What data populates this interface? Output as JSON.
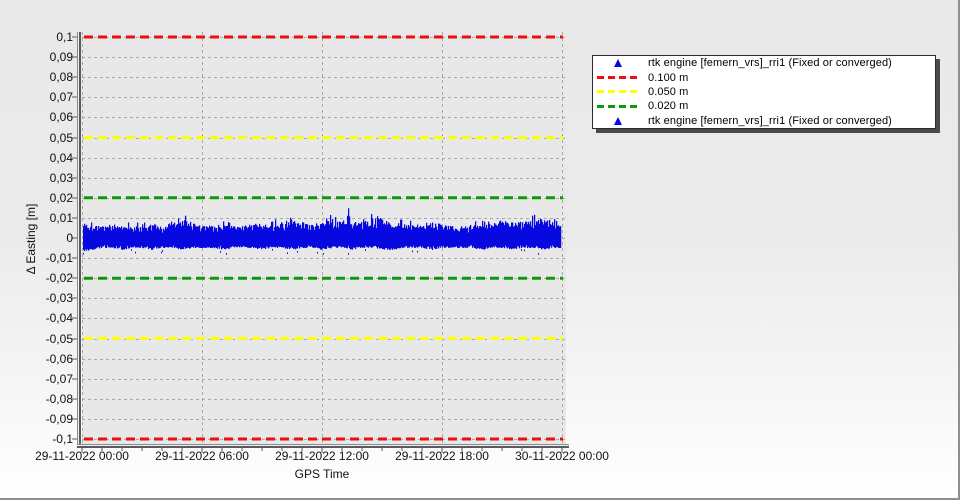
{
  "colors": {
    "plot_bg": "#e8e8e8",
    "grid": "#a8a8a8",
    "axis": "#5a5a5a",
    "series_blue": "#0808e0",
    "threshold_red": "#ee0e0e",
    "threshold_yellow": "#ffff00",
    "threshold_green": "#089b08",
    "legend_bg": "#ffffff",
    "window_bg_top": "#e9e9e9",
    "window_bg_bottom": "#ffffff"
  },
  "legend": {
    "items": [
      {
        "symbol": "triangle",
        "color": "#0808e0",
        "label": "rtk engine [femern_vrs]_rri1 (Fixed or converged)"
      },
      {
        "symbol": "dash",
        "color": "#ee0e0e",
        "label": "0.100 m"
      },
      {
        "symbol": "dash",
        "color": "#ffff00",
        "label": "0.050 m"
      },
      {
        "symbol": "dash",
        "color": "#089b08",
        "label": "0.020 m"
      },
      {
        "symbol": "triangle",
        "color": "#0808e0",
        "label": "rtk engine [femern_vrs]_rri1 (Fixed or converged)"
      }
    ]
  },
  "chart_data": {
    "type": "scatter",
    "title": "",
    "xlabel": "GPS Time",
    "ylabel": "Δ Easting [m]",
    "ylim": [
      -0.1,
      0.1
    ],
    "y_tick_step": 0.01,
    "y_tick_labels": [
      "0,1",
      "0,09",
      "0,08",
      "0,07",
      "0,06",
      "0,05",
      "0,04",
      "0,03",
      "0,02",
      "0,01",
      "0",
      "-0,01",
      "-0,02",
      "-0,03",
      "-0,04",
      "-0,05",
      "-0,06",
      "-0,07",
      "-0,08",
      "-0,09",
      "-0,1"
    ],
    "x_range_hours": [
      0,
      24
    ],
    "x_major_tick_hours": 6,
    "x_minor_tick_hours": 1,
    "x_tick_labels": [
      "29-11-2022 00:00",
      "29-11-2022 06:00",
      "29-11-2022 12:00",
      "29-11-2022 18:00",
      "30-11-2022 00:00"
    ],
    "grid": "dashed",
    "legend_position": "outside-right",
    "thresholds": [
      {
        "value": 0.1,
        "color": "#ee0e0e",
        "label": "0.100 m"
      },
      {
        "value": -0.1,
        "color": "#ee0e0e",
        "label": "0.100 m"
      },
      {
        "value": 0.05,
        "color": "#ffff00",
        "label": "0.050 m"
      },
      {
        "value": -0.05,
        "color": "#ffff00",
        "label": "0.050 m"
      },
      {
        "value": 0.02,
        "color": "#089b08",
        "label": "0.020 m"
      },
      {
        "value": -0.02,
        "color": "#089b08",
        "label": "0.020 m"
      }
    ],
    "series": [
      {
        "name": "rtk engine [femern_vrs]_rri1 (Fixed or converged)",
        "marker": "triangle",
        "color": "#0808e0",
        "description": "dense noise band of Δ Easting residuals around 0 m",
        "envelope_t_step_h": 0.5,
        "upper_envelope_m": [
          0.007,
          0.006,
          0.006,
          0.007,
          0.006,
          0.006,
          0.006,
          0.007,
          0.006,
          0.008,
          0.009,
          0.008,
          0.006,
          0.006,
          0.007,
          0.006,
          0.006,
          0.007,
          0.006,
          0.007,
          0.008,
          0.01,
          0.008,
          0.007,
          0.008,
          0.01,
          0.008,
          0.008,
          0.008,
          0.01,
          0.01,
          0.008,
          0.007,
          0.007,
          0.006,
          0.008,
          0.007,
          0.006,
          0.006,
          0.007,
          0.007,
          0.008,
          0.009,
          0.008,
          0.008,
          0.009,
          0.01,
          0.008,
          0.007
        ],
        "lower_envelope_m": [
          -0.007,
          -0.006,
          -0.005,
          -0.005,
          -0.006,
          -0.005,
          -0.005,
          -0.006,
          -0.005,
          -0.005,
          -0.006,
          -0.005,
          -0.005,
          -0.005,
          -0.006,
          -0.005,
          -0.005,
          -0.005,
          -0.006,
          -0.005,
          -0.005,
          -0.006,
          -0.005,
          -0.005,
          -0.006,
          -0.005,
          -0.005,
          -0.006,
          -0.005,
          -0.005,
          -0.006,
          -0.006,
          -0.005,
          -0.005,
          -0.005,
          -0.006,
          -0.005,
          -0.005,
          -0.005,
          -0.005,
          -0.006,
          -0.005,
          -0.005,
          -0.006,
          -0.005,
          -0.005,
          -0.006,
          -0.005,
          -0.005
        ],
        "spikes": [
          {
            "t_h": 5.15,
            "peak_m": 0.0125,
            "width_h": 0.25
          },
          {
            "t_h": 10.4,
            "peak_m": 0.0105,
            "width_h": 0.2
          },
          {
            "t_h": 12.4,
            "peak_m": 0.0115,
            "width_h": 0.18
          },
          {
            "t_h": 13.3,
            "peak_m": 0.0165,
            "width_h": 0.22
          },
          {
            "t_h": 14.9,
            "peak_m": 0.0105,
            "width_h": 0.18
          },
          {
            "t_h": 23.1,
            "peak_m": 0.0095,
            "width_h": 0.2
          }
        ]
      }
    ]
  }
}
